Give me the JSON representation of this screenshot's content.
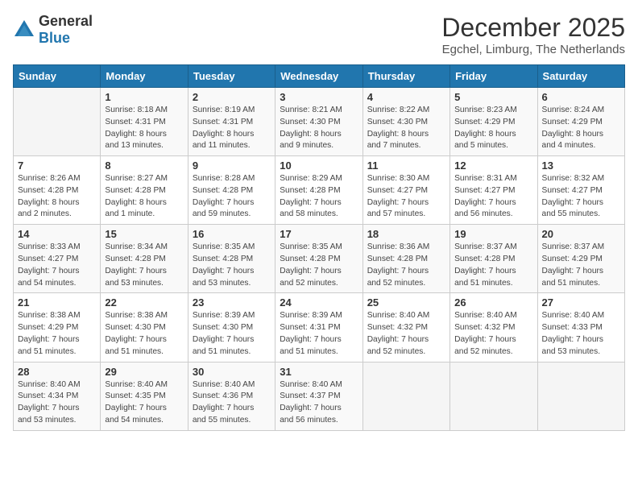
{
  "header": {
    "logo_general": "General",
    "logo_blue": "Blue",
    "month_title": "December 2025",
    "subtitle": "Egchel, Limburg, The Netherlands"
  },
  "weekdays": [
    "Sunday",
    "Monday",
    "Tuesday",
    "Wednesday",
    "Thursday",
    "Friday",
    "Saturday"
  ],
  "weeks": [
    [
      {
        "day": "",
        "info": ""
      },
      {
        "day": "1",
        "info": "Sunrise: 8:18 AM\nSunset: 4:31 PM\nDaylight: 8 hours\nand 13 minutes."
      },
      {
        "day": "2",
        "info": "Sunrise: 8:19 AM\nSunset: 4:31 PM\nDaylight: 8 hours\nand 11 minutes."
      },
      {
        "day": "3",
        "info": "Sunrise: 8:21 AM\nSunset: 4:30 PM\nDaylight: 8 hours\nand 9 minutes."
      },
      {
        "day": "4",
        "info": "Sunrise: 8:22 AM\nSunset: 4:30 PM\nDaylight: 8 hours\nand 7 minutes."
      },
      {
        "day": "5",
        "info": "Sunrise: 8:23 AM\nSunset: 4:29 PM\nDaylight: 8 hours\nand 5 minutes."
      },
      {
        "day": "6",
        "info": "Sunrise: 8:24 AM\nSunset: 4:29 PM\nDaylight: 8 hours\nand 4 minutes."
      }
    ],
    [
      {
        "day": "7",
        "info": "Sunrise: 8:26 AM\nSunset: 4:28 PM\nDaylight: 8 hours\nand 2 minutes."
      },
      {
        "day": "8",
        "info": "Sunrise: 8:27 AM\nSunset: 4:28 PM\nDaylight: 8 hours\nand 1 minute."
      },
      {
        "day": "9",
        "info": "Sunrise: 8:28 AM\nSunset: 4:28 PM\nDaylight: 7 hours\nand 59 minutes."
      },
      {
        "day": "10",
        "info": "Sunrise: 8:29 AM\nSunset: 4:28 PM\nDaylight: 7 hours\nand 58 minutes."
      },
      {
        "day": "11",
        "info": "Sunrise: 8:30 AM\nSunset: 4:27 PM\nDaylight: 7 hours\nand 57 minutes."
      },
      {
        "day": "12",
        "info": "Sunrise: 8:31 AM\nSunset: 4:27 PM\nDaylight: 7 hours\nand 56 minutes."
      },
      {
        "day": "13",
        "info": "Sunrise: 8:32 AM\nSunset: 4:27 PM\nDaylight: 7 hours\nand 55 minutes."
      }
    ],
    [
      {
        "day": "14",
        "info": "Sunrise: 8:33 AM\nSunset: 4:27 PM\nDaylight: 7 hours\nand 54 minutes."
      },
      {
        "day": "15",
        "info": "Sunrise: 8:34 AM\nSunset: 4:28 PM\nDaylight: 7 hours\nand 53 minutes."
      },
      {
        "day": "16",
        "info": "Sunrise: 8:35 AM\nSunset: 4:28 PM\nDaylight: 7 hours\nand 53 minutes."
      },
      {
        "day": "17",
        "info": "Sunrise: 8:35 AM\nSunset: 4:28 PM\nDaylight: 7 hours\nand 52 minutes."
      },
      {
        "day": "18",
        "info": "Sunrise: 8:36 AM\nSunset: 4:28 PM\nDaylight: 7 hours\nand 52 minutes."
      },
      {
        "day": "19",
        "info": "Sunrise: 8:37 AM\nSunset: 4:28 PM\nDaylight: 7 hours\nand 51 minutes."
      },
      {
        "day": "20",
        "info": "Sunrise: 8:37 AM\nSunset: 4:29 PM\nDaylight: 7 hours\nand 51 minutes."
      }
    ],
    [
      {
        "day": "21",
        "info": "Sunrise: 8:38 AM\nSunset: 4:29 PM\nDaylight: 7 hours\nand 51 minutes."
      },
      {
        "day": "22",
        "info": "Sunrise: 8:38 AM\nSunset: 4:30 PM\nDaylight: 7 hours\nand 51 minutes."
      },
      {
        "day": "23",
        "info": "Sunrise: 8:39 AM\nSunset: 4:30 PM\nDaylight: 7 hours\nand 51 minutes."
      },
      {
        "day": "24",
        "info": "Sunrise: 8:39 AM\nSunset: 4:31 PM\nDaylight: 7 hours\nand 51 minutes."
      },
      {
        "day": "25",
        "info": "Sunrise: 8:40 AM\nSunset: 4:32 PM\nDaylight: 7 hours\nand 52 minutes."
      },
      {
        "day": "26",
        "info": "Sunrise: 8:40 AM\nSunset: 4:32 PM\nDaylight: 7 hours\nand 52 minutes."
      },
      {
        "day": "27",
        "info": "Sunrise: 8:40 AM\nSunset: 4:33 PM\nDaylight: 7 hours\nand 53 minutes."
      }
    ],
    [
      {
        "day": "28",
        "info": "Sunrise: 8:40 AM\nSunset: 4:34 PM\nDaylight: 7 hours\nand 53 minutes."
      },
      {
        "day": "29",
        "info": "Sunrise: 8:40 AM\nSunset: 4:35 PM\nDaylight: 7 hours\nand 54 minutes."
      },
      {
        "day": "30",
        "info": "Sunrise: 8:40 AM\nSunset: 4:36 PM\nDaylight: 7 hours\nand 55 minutes."
      },
      {
        "day": "31",
        "info": "Sunrise: 8:40 AM\nSunset: 4:37 PM\nDaylight: 7 hours\nand 56 minutes."
      },
      {
        "day": "",
        "info": ""
      },
      {
        "day": "",
        "info": ""
      },
      {
        "day": "",
        "info": ""
      }
    ]
  ]
}
